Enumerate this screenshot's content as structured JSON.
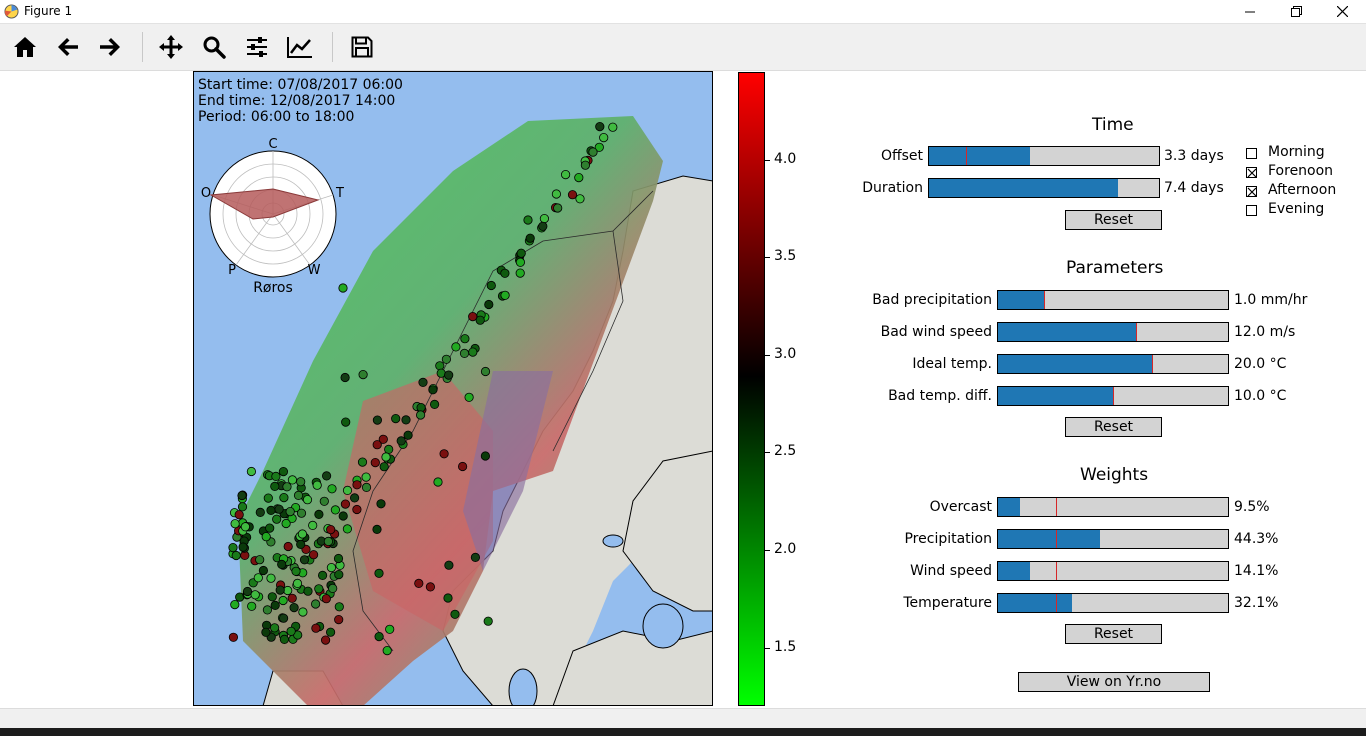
{
  "window": {
    "title": "Figure 1"
  },
  "toolbar": {
    "buttons": [
      "home-icon",
      "back-arrow-icon",
      "forward-arrow-icon",
      "pan-icon",
      "zoom-icon",
      "configure-subplots-icon",
      "edit-axis-icon",
      "save-icon"
    ]
  },
  "map": {
    "start_time": "Start time: 07/08/2017 06:00",
    "end_time": "End time: 12/08/2017 14:00",
    "period": "Period: 06:00 to 18:00",
    "polar": {
      "labels": {
        "top": "C",
        "right": "T",
        "bottom_right": "W",
        "bottom_left": "P",
        "left": "O"
      },
      "location": "Røros",
      "fill_color": "#b55a5a"
    },
    "colors": {
      "sea": "#94bdee",
      "land": "#dcdcd6"
    }
  },
  "colorbar": {
    "ticks": [
      "4.0",
      "3.5",
      "3.0",
      "2.5",
      "2.0",
      "1.5"
    ],
    "tick_values": [
      4.0,
      3.5,
      3.0,
      2.5,
      2.0,
      1.5
    ],
    "range": [
      1.2,
      4.45
    ],
    "colors": [
      "#00ff00",
      "#000000",
      "#ff0000"
    ]
  },
  "time": {
    "heading": "Time",
    "offset": {
      "label": "Offset",
      "value": "3.3 days",
      "fraction": 0.44,
      "marker": 0.16
    },
    "duration": {
      "label": "Duration",
      "value": "7.4 days",
      "fraction": 0.82
    },
    "reset": "Reset",
    "checks": [
      {
        "label": "Morning",
        "checked": false
      },
      {
        "label": "Forenoon",
        "checked": true
      },
      {
        "label": "Afternoon",
        "checked": true
      },
      {
        "label": "Evening",
        "checked": false
      }
    ]
  },
  "parameters": {
    "heading": "Parameters",
    "rows": [
      {
        "label": "Bad precipitation",
        "value": "1.0 mm/hr",
        "fraction": 0.2
      },
      {
        "label": "Bad wind speed",
        "value": "12.0 m/s",
        "fraction": 0.6
      },
      {
        "label": "Ideal temp.",
        "value": "20.0 °C",
        "fraction": 0.67
      },
      {
        "label": "Bad temp. diff.",
        "value": "10.0 °C",
        "fraction": 0.5
      }
    ],
    "reset": "Reset"
  },
  "weights": {
    "heading": "Weights",
    "rows": [
      {
        "label": "Overcast",
        "value": "9.5%",
        "fraction": 0.095
      },
      {
        "label": "Precipitation",
        "value": "44.3%",
        "fraction": 0.443
      },
      {
        "label": "Wind speed",
        "value": "14.1%",
        "fraction": 0.141
      },
      {
        "label": "Temperature",
        "value": "32.1%",
        "fraction": 0.321
      }
    ],
    "marker": 0.25,
    "reset": "Reset"
  },
  "view_button": "View on Yr.no"
}
